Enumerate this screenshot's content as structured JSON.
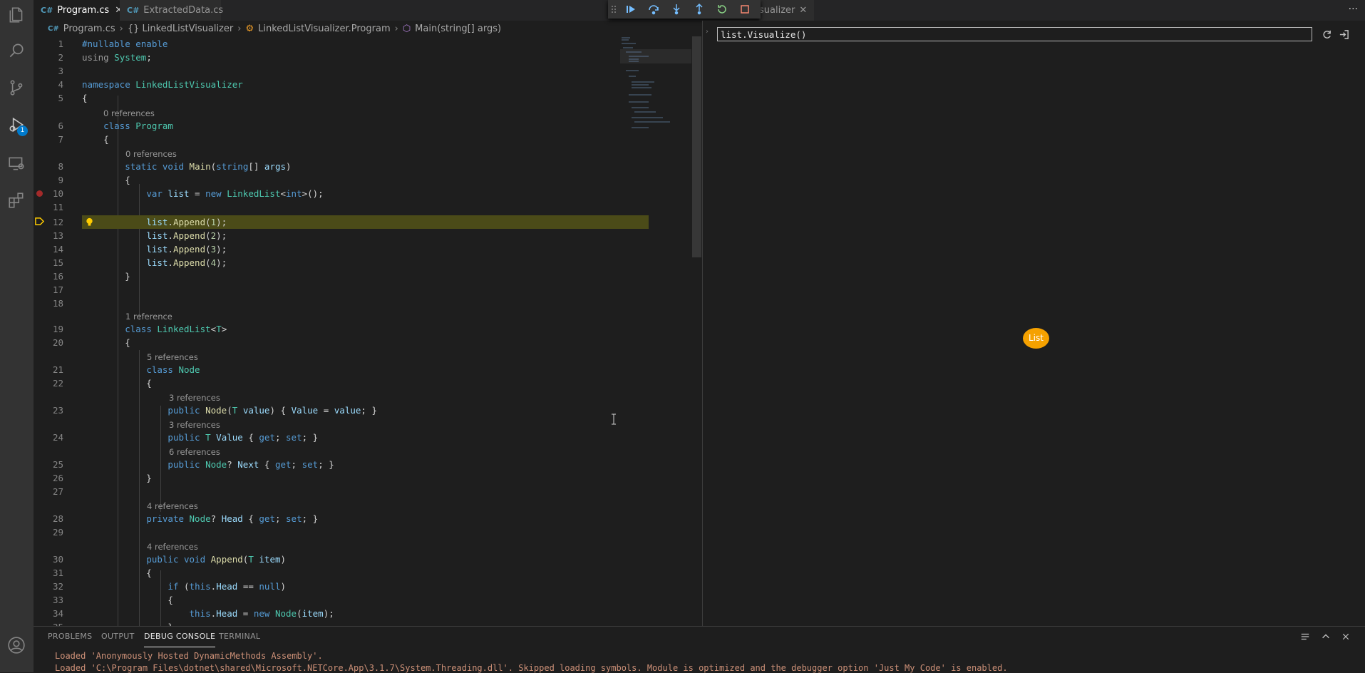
{
  "tabs": {
    "program": "Program.cs",
    "extracted": "ExtractedData.cs",
    "visualizer_partial": "sualizer",
    "cs_glyph": "C#"
  },
  "breadcrumb": {
    "file": "Program.cs",
    "namespace": "{} LinkedListVisualizer",
    "class": "LinkedListVisualizer.Program",
    "method": "Main(string[] args)"
  },
  "activity": {
    "debug_badge": "1"
  },
  "code_lens": {
    "l6": "0 references",
    "l8": "0 references",
    "l19": "1 reference",
    "l21": "5 references",
    "l23": "3 references",
    "l24": "3 references",
    "l25": "6 references",
    "l28": "4 references",
    "l30": "4 references"
  },
  "visualizer": {
    "expression": "list.Visualize()",
    "node_label": "List"
  },
  "bottom_panel": {
    "tabs": [
      "PROBLEMS",
      "OUTPUT",
      "DEBUG CONSOLE",
      "TERMINAL"
    ],
    "console_lines": [
      "Loaded 'Anonymously Hosted DynamicMethods Assembly'.",
      "Loaded 'C:\\Program Files\\dotnet\\shared\\Microsoft.NETCore.App\\3.1.7\\System.Threading.dll'. Skipped loading symbols. Module is optimized and the debugger option 'Just My Code' is enabled."
    ]
  },
  "colors": {
    "accent": "#007acc",
    "current_line": "#4b4b18",
    "node": "#f5a100",
    "breakpoint": "#e51400"
  }
}
